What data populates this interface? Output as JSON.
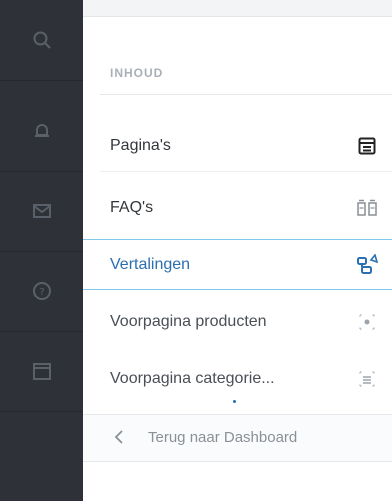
{
  "rail": {
    "items": [
      {
        "icon": "search-icon"
      },
      {
        "icon": "bell-icon"
      },
      {
        "icon": "mail-icon"
      },
      {
        "icon": "help-icon"
      },
      {
        "icon": "calendar-icon"
      }
    ]
  },
  "panel": {
    "section_title": "INHOUD",
    "items": [
      {
        "label": "Pagina's",
        "icon": "pages-icon"
      },
      {
        "label": "FAQ's",
        "icon": "faq-icon"
      },
      {
        "label": "Vertalingen",
        "icon": "translations-icon",
        "active": true
      },
      {
        "label": "Voorpagina producten",
        "icon": "frontpage-products-icon"
      },
      {
        "label": "Voorpagina categorie...",
        "icon": "frontpage-categories-icon"
      }
    ],
    "back_label": "Terug naar Dashboard"
  },
  "colors": {
    "rail_bg": "#2e3138",
    "active_text": "#2b6fb0",
    "active_border": "#7fc9ea"
  }
}
